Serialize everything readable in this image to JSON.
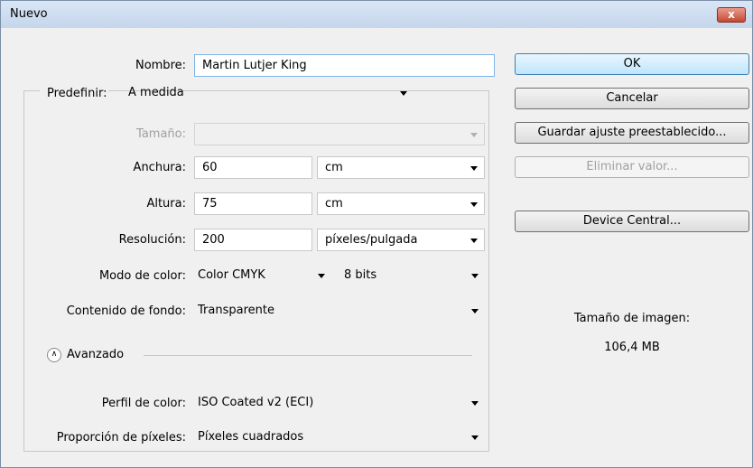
{
  "window": {
    "title": "Nuevo",
    "close_label": "x"
  },
  "fields": {
    "nombre": {
      "label": "Nombre:",
      "value": "Martin Lutjer King"
    },
    "predefinir": {
      "label": "Predefinir:",
      "value": "A medida"
    },
    "tamano": {
      "label": "Tamaño:",
      "value": ""
    },
    "anchura": {
      "label": "Anchura:",
      "value": "60",
      "unit": "cm"
    },
    "altura": {
      "label": "Altura:",
      "value": "75",
      "unit": "cm"
    },
    "resolucion": {
      "label": "Resolución:",
      "value": "200",
      "unit": "píxeles/pulgada"
    },
    "modo_color": {
      "label": "Modo de color:",
      "value": "Color CMYK",
      "bits": "8 bits"
    },
    "contenido_fondo": {
      "label": "Contenido de fondo:",
      "value": "Transparente"
    },
    "avanzado": {
      "label": "Avanzado",
      "icon": "collapse-chevron-icon"
    },
    "perfil_color": {
      "label": "Perfil de color:",
      "value": "ISO Coated v2 (ECI)"
    },
    "proporcion": {
      "label": "Proporción de píxeles:",
      "value": "Píxeles cuadrados"
    }
  },
  "buttons": {
    "ok": "OK",
    "cancel": "Cancelar",
    "save_preset": "Guardar ajuste preestablecido...",
    "delete_preset": "Eliminar valor...",
    "device_central": "Device Central..."
  },
  "image_size": {
    "label": "Tamaño de imagen:",
    "value": "106,4 MB"
  }
}
